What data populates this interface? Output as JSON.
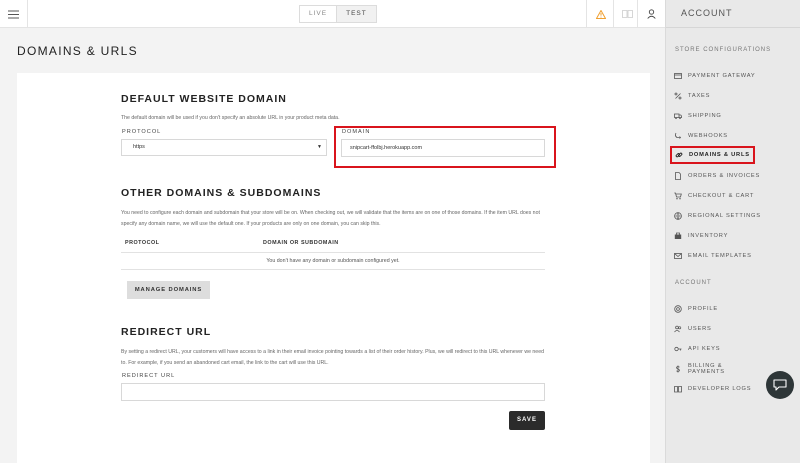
{
  "topbar": {
    "mode_live": "LIVE",
    "mode_test": "TEST"
  },
  "sidebar": {
    "header": "ACCOUNT",
    "section_store": "STORE CONFIGURATIONS",
    "section_account": "ACCOUNT",
    "store_items": [
      {
        "label": "PAYMENT GATEWAY",
        "icon": "credit-card-icon"
      },
      {
        "label": "TAXES",
        "icon": "percent-icon"
      },
      {
        "label": "SHIPPING",
        "icon": "truck-icon"
      },
      {
        "label": "WEBHOOKS",
        "icon": "webhook-icon"
      },
      {
        "label": "DOMAINS & URLS",
        "icon": "link-icon",
        "active": true
      },
      {
        "label": "ORDERS & INVOICES",
        "icon": "document-icon"
      },
      {
        "label": "CHECKOUT & CART",
        "icon": "cart-icon"
      },
      {
        "label": "REGIONAL SETTINGS",
        "icon": "globe-icon"
      },
      {
        "label": "INVENTORY",
        "icon": "box-icon"
      },
      {
        "label": "EMAIL TEMPLATES",
        "icon": "envelope-icon"
      }
    ],
    "account_items": [
      {
        "label": "PROFILE",
        "icon": "profile-icon"
      },
      {
        "label": "USERS",
        "icon": "users-icon"
      },
      {
        "label": "API KEYS",
        "icon": "key-icon"
      },
      {
        "label": "BILLING & PAYMENTS",
        "icon": "dollar-icon"
      },
      {
        "label": "DEVELOPER LOGS",
        "icon": "book-icon"
      }
    ]
  },
  "page": {
    "title": "DOMAINS & URLS"
  },
  "default_domain": {
    "heading": "DEFAULT WEBSITE DOMAIN",
    "description": "The default domain will be used if you don't specify an absolute URL in your product meta data.",
    "protocol_label": "PROTOCOL",
    "protocol_value": "https",
    "domain_label": "DOMAIN",
    "domain_value": "snipcart-ffolbj.herokuapp.com"
  },
  "other_domains": {
    "heading": "OTHER DOMAINS & SUBDOMAINS",
    "description": "You need to configure each domain and subdomain that your store will be on. When checking out, we will validate that the items are on one of those domains. If the item URL does not specify any domain name, we will use the default one. If your products are only on one domain, you can skip this.",
    "col_protocol": "PROTOCOL",
    "col_domain": "DOMAIN OR SUBDOMAIN",
    "empty_message": "You don't have any domain or subdomain configured yet.",
    "manage_button": "MANAGE DOMAINS"
  },
  "redirect": {
    "heading": "REDIRECT URL",
    "description": "By setting a redirect URL, your customers will have access to a link in their email invoice pointing towards a list of their order history. Plus, we will redirect to this URL whenever we need to. For example, if you send an abandoned cart email, the link to the cart will use this URL.",
    "label": "REDIRECT URL",
    "value": "",
    "save_button": "SAVE"
  },
  "colors": {
    "highlight": "#d9141c",
    "warning": "#f0a030",
    "dark_button": "#2b2b2b"
  }
}
